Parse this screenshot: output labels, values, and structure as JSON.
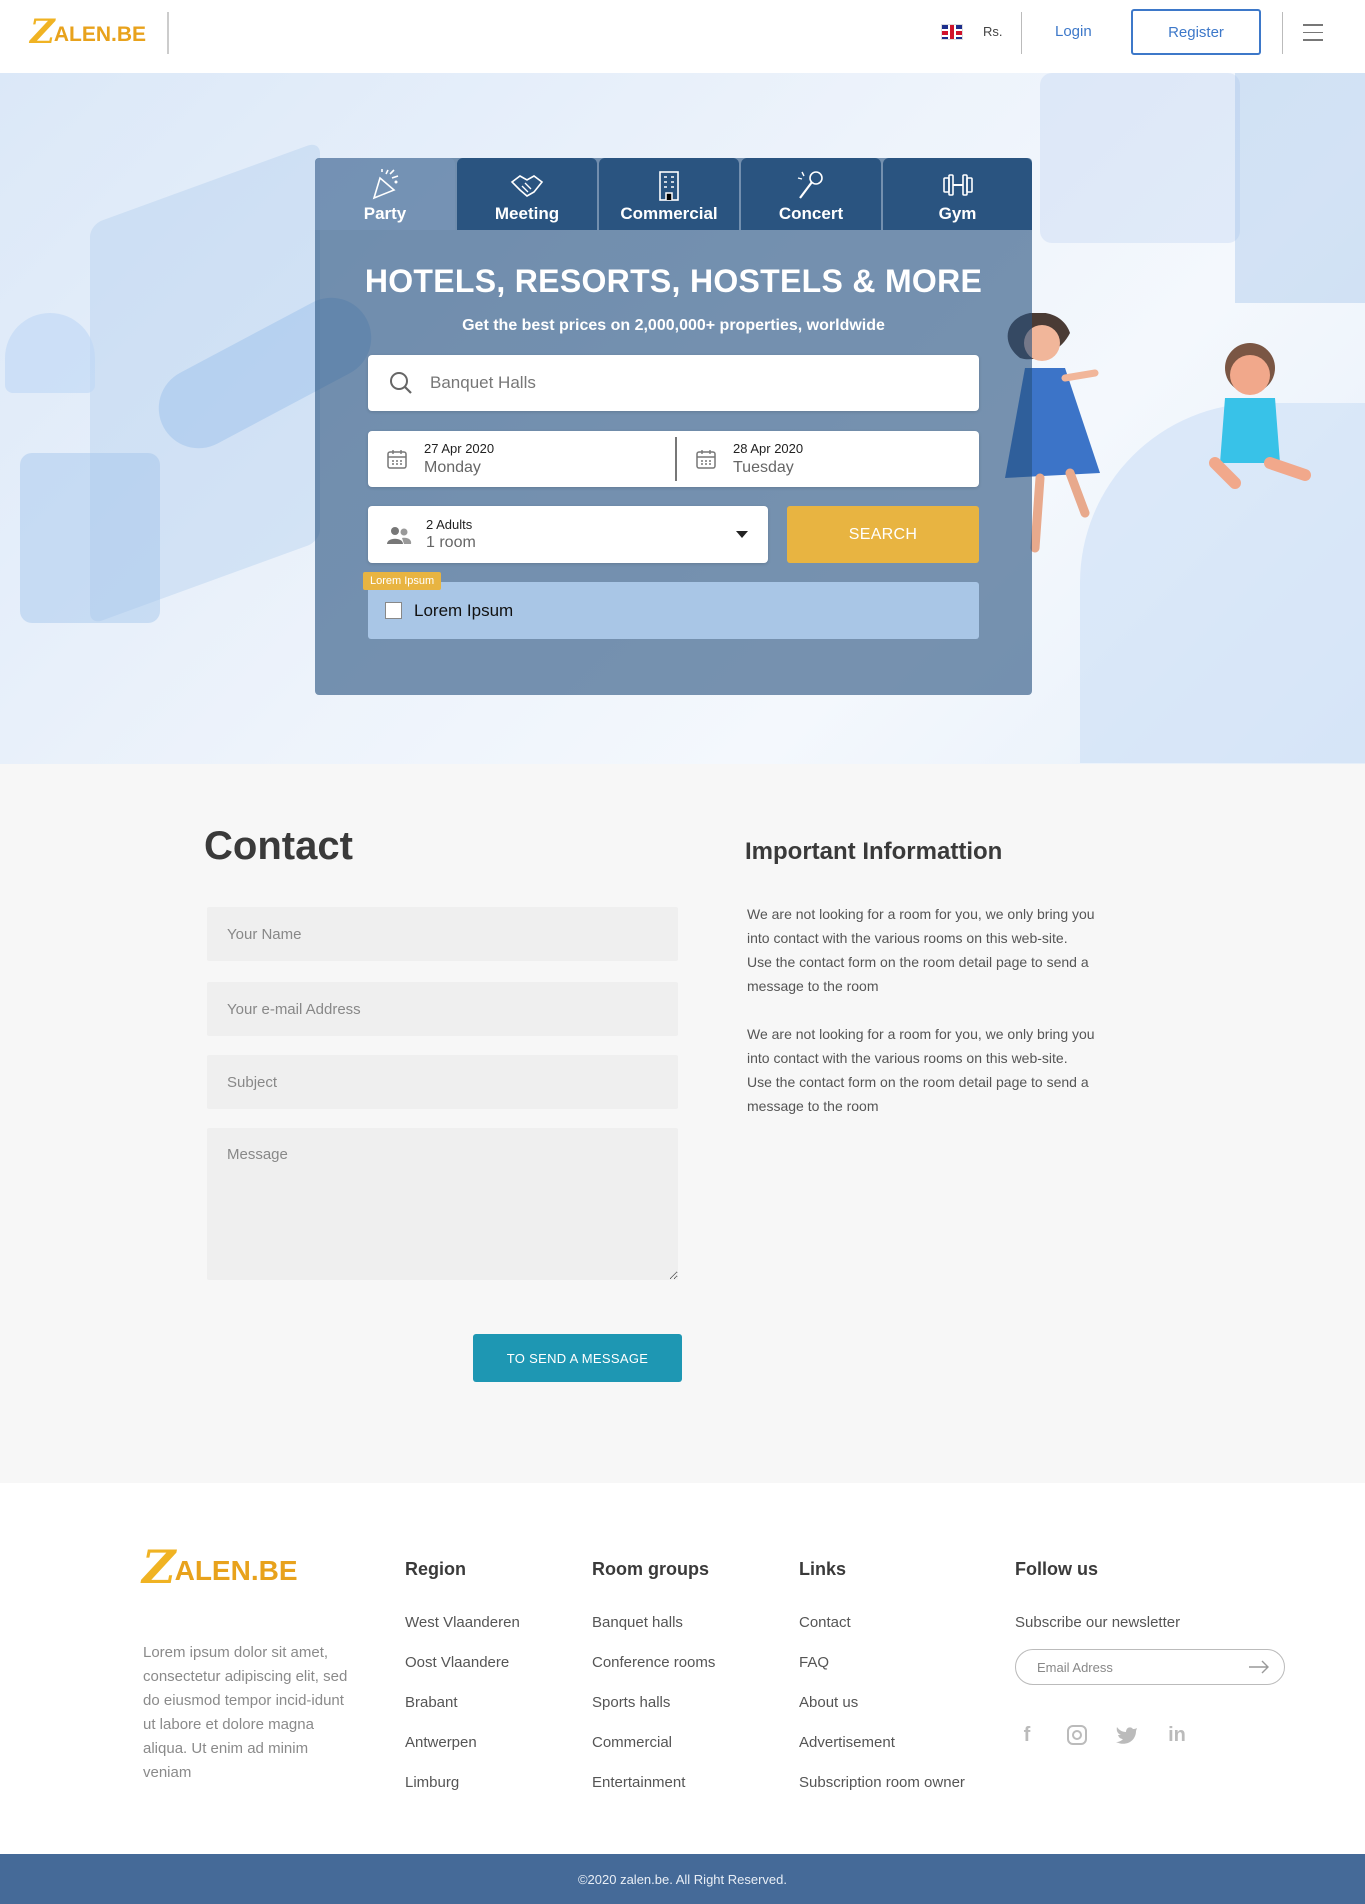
{
  "header": {
    "logo_mark": "Z",
    "logo_text": "ALEN.BE",
    "currency": "Rs.",
    "login": "Login",
    "register": "Register"
  },
  "hero": {
    "tabs": [
      {
        "label": "Party",
        "icon": "party-popper-icon"
      },
      {
        "label": "Meeting",
        "icon": "handshake-icon"
      },
      {
        "label": "Commercial",
        "icon": "building-icon"
      },
      {
        "label": "Concert",
        "icon": "microphone-icon"
      },
      {
        "label": "Gym",
        "icon": "dumbbell-icon"
      }
    ],
    "active_tab": "Party",
    "title": "HOTELS, RESORTS, HOSTELS & MORE",
    "subtitle": "Get the best prices on 2,000,000+ properties, worldwide",
    "search_placeholder": "Banquet Halls",
    "checkin": {
      "date": "27 Apr 2020",
      "day": "Monday"
    },
    "checkout": {
      "date": "28 Apr 2020",
      "day": "Tuesday"
    },
    "guests": {
      "adults": "2 Adults",
      "rooms": "1 room"
    },
    "search_button": "SEARCH",
    "checkbox_tag": "Lorem Ipsum",
    "checkbox_label": "Lorem Ipsum"
  },
  "contact": {
    "title": "Contact",
    "name_placeholder": "Your Name",
    "email_placeholder": "Your e-mail Address",
    "subject_placeholder": "Subject",
    "message_placeholder": "Message",
    "send_button": "TO SEND A MESSAGE",
    "info_title": "Important Informattion",
    "info_paragraphs": [
      "We are not looking for a room for you, we only bring you into contact with the various rooms on this web-site.",
      "Use the contact form on the room detail page to send a message to the room",
      "We are not looking for a room for you, we only bring you into contact with the various rooms on this web-site.",
      "Use the contact form on the room detail page to send a message to the room"
    ]
  },
  "footer": {
    "logo_mark": "Z",
    "logo_text": "ALEN.BE",
    "about": "Lorem ipsum dolor sit amet, consectetur adipiscing elit, sed do eiusmod tempor incid-idunt ut labore et dolore magna aliqua. Ut enim ad minim veniam",
    "region": {
      "title": "Region",
      "items": [
        "West Vlaanderen",
        "Oost Vlaandere",
        "Brabant",
        "Antwerpen",
        "Limburg"
      ]
    },
    "room_groups": {
      "title": "Room groups",
      "items": [
        "Banquet halls",
        "Conference rooms",
        "Sports halls",
        "Commercial",
        "Entertainment"
      ]
    },
    "links": {
      "title": "Links",
      "items": [
        "Contact",
        "FAQ",
        "About us",
        "Advertisement",
        "Subscription room owner"
      ]
    },
    "follow": {
      "title": "Follow us",
      "newsletter_label": "Subscribe our newsletter",
      "email_placeholder": "Email Adress",
      "social": [
        "facebook-icon",
        "instagram-icon",
        "twitter-icon",
        "linkedin-icon"
      ]
    },
    "copyright": "©2020 zalen.be. All Right Reserved."
  },
  "colors": {
    "brand_gold": "#e8b441",
    "link_blue": "#3d78c9",
    "panel_blue": "#2a5480",
    "send_teal": "#1e97b3",
    "footer_bar": "#456a98"
  }
}
